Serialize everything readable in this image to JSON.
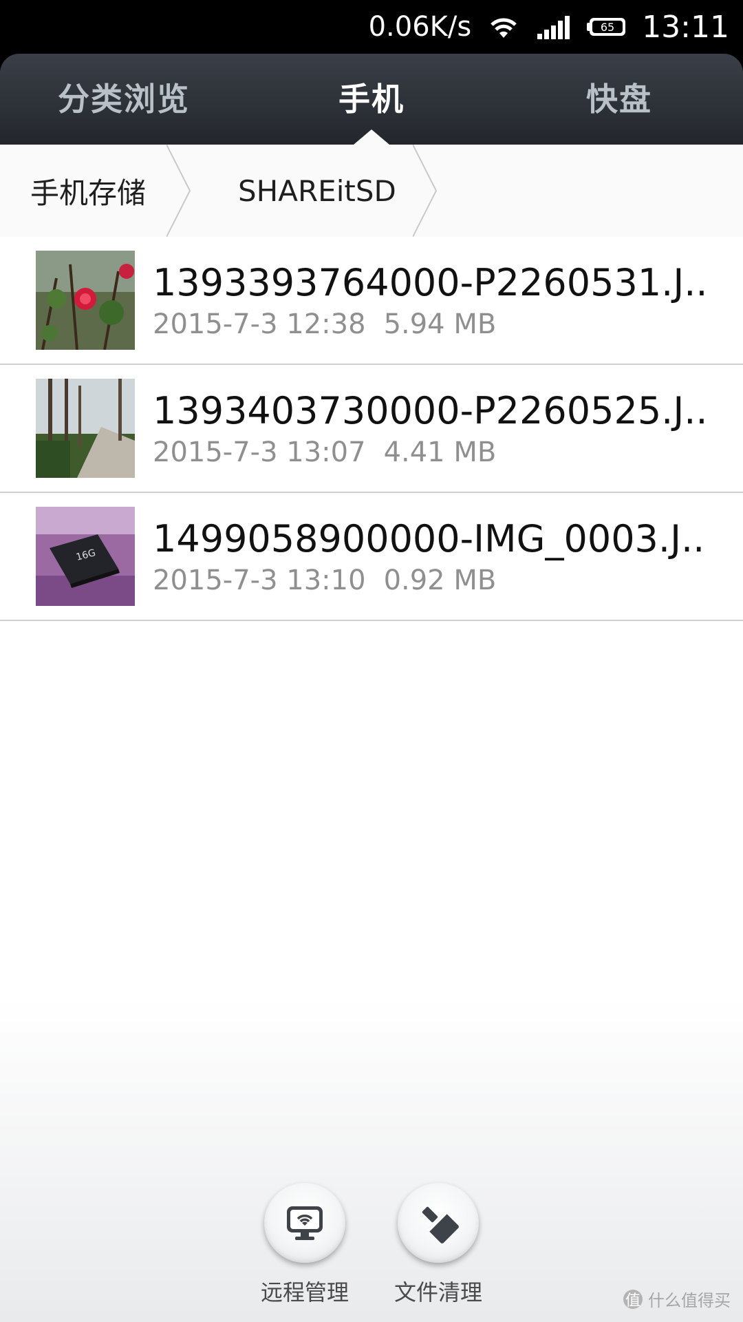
{
  "status_bar": {
    "net_speed": "0.06K/s",
    "battery": "65",
    "time": "13:11"
  },
  "tabs": [
    {
      "label": "分类浏览",
      "active": false
    },
    {
      "label": "手机",
      "active": true
    },
    {
      "label": "快盘",
      "active": false
    }
  ],
  "breadcrumb": [
    {
      "label": "手机存储"
    },
    {
      "label": "SHAREitSD"
    }
  ],
  "files": [
    {
      "name": "1393393764000-P2260531.J..",
      "date": "2015-7-3 12:38",
      "size": "5.94 MB",
      "thumb": "flower-photo"
    },
    {
      "name": "1393403730000-P2260525.J..",
      "date": "2015-7-3 13:07",
      "size": "4.41 MB",
      "thumb": "path-photo"
    },
    {
      "name": "1499058900000-IMG_0003.J..",
      "date": "2015-7-3 13:10",
      "size": "0.92 MB",
      "thumb": "sd-card-photo"
    }
  ],
  "actions": [
    {
      "label": "远程管理",
      "icon": "remote-monitor-icon"
    },
    {
      "label": "文件清理",
      "icon": "broom-icon"
    }
  ],
  "watermark": {
    "badge": "值",
    "text": "什么值得买"
  },
  "colors": {
    "tab_bar": "#2b2f35",
    "active_tab": "#ffffff",
    "inactive_tab": "#b9c0c8",
    "secondary_text": "#8f8f8f"
  }
}
